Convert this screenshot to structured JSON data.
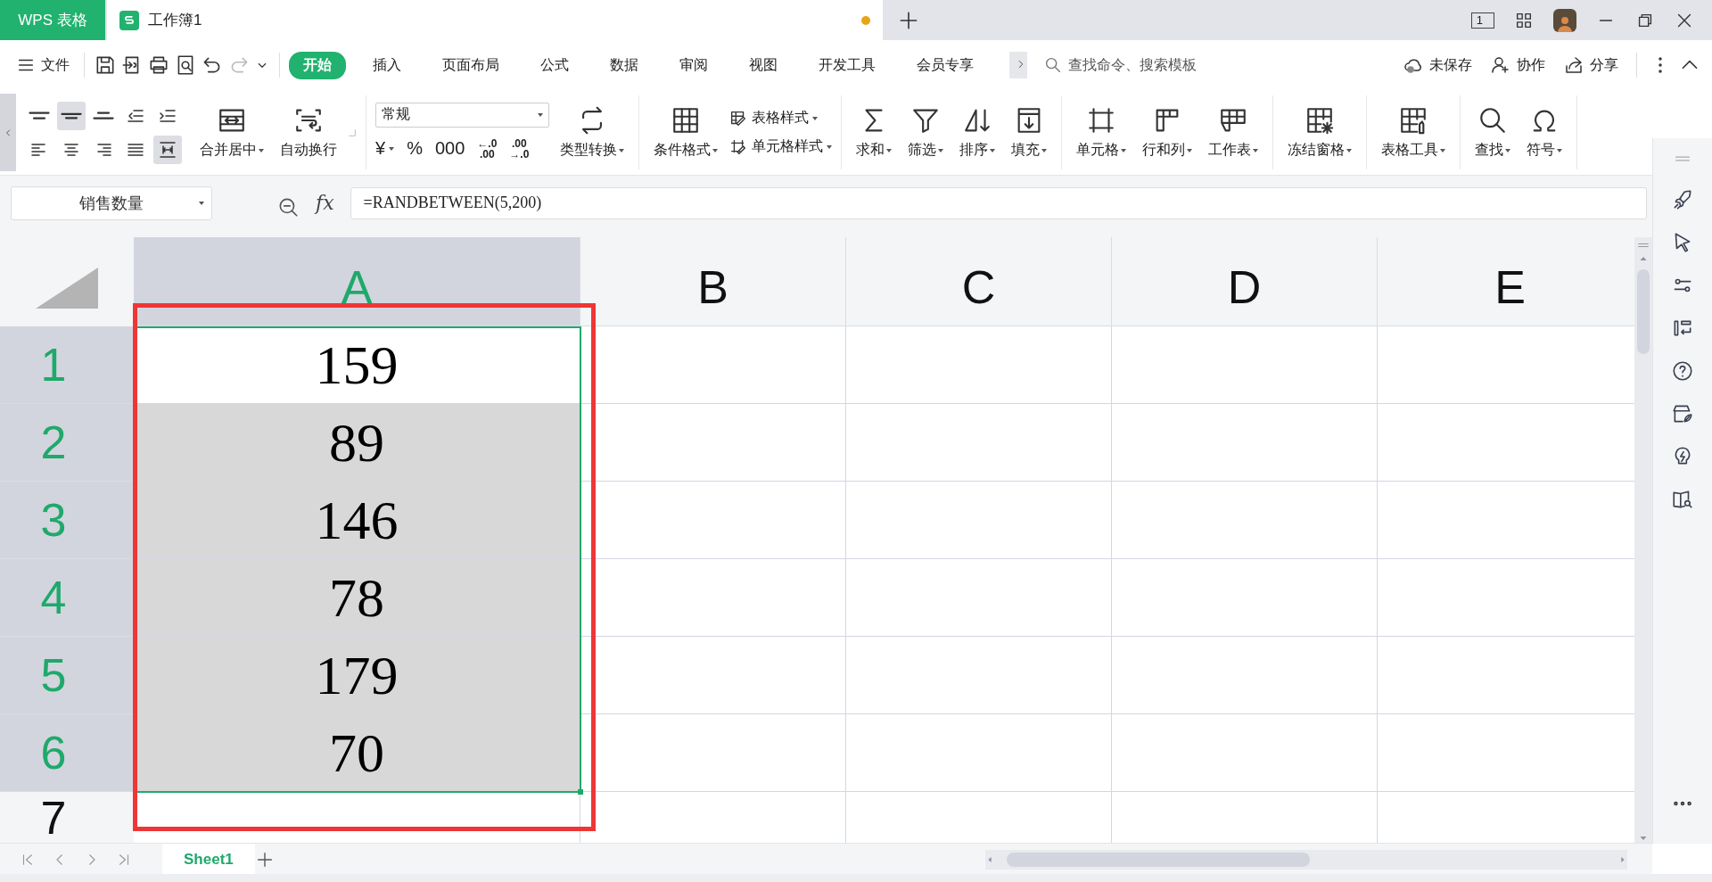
{
  "title_bar": {
    "app_tab": "WPS 表格",
    "doc_tab": {
      "title": "工作簿1",
      "modified": true
    },
    "page_indicator": "1"
  },
  "menu": {
    "file": "文件",
    "tabs": [
      {
        "label": "开始",
        "selected": true
      },
      {
        "label": "插入",
        "selected": false
      },
      {
        "label": "页面布局",
        "selected": false
      },
      {
        "label": "公式",
        "selected": false
      },
      {
        "label": "数据",
        "selected": false
      },
      {
        "label": "审阅",
        "selected": false
      },
      {
        "label": "视图",
        "selected": false
      },
      {
        "label": "开发工具",
        "selected": false
      },
      {
        "label": "会员专享",
        "selected": false
      }
    ],
    "search": {
      "placeholder": "查找命令、搜索模板"
    },
    "save_status": "未保存",
    "collaborate": "协作",
    "share": "分享"
  },
  "ribbon": {
    "groups": [
      {
        "kind": "align",
        "buttons": [
          {
            "selected": false
          },
          {
            "selected": true
          },
          {
            "selected": false
          },
          {
            "selected": false
          },
          {
            "selected": false
          },
          {
            "selected": false
          },
          {
            "selected": false
          },
          {
            "selected": false
          },
          {
            "selected": false
          },
          {
            "selected": true
          }
        ],
        "items": [
          {
            "label": "合并居中",
            "dropdown": true
          },
          {
            "label": "自动换行",
            "dropdown": false
          }
        ]
      },
      {
        "kind": "number",
        "format": "常规",
        "buttons": [
          {
            "kind": "text",
            "label": "¥",
            "dropdown": true
          },
          {
            "kind": "text",
            "label": "%"
          },
          {
            "kind": "text",
            "label": "000"
          },
          {
            "kind": "stack",
            "top": "←.0",
            "bottom": ".00"
          },
          {
            "kind": "stack",
            "top": ".00",
            "bottom": "→.0"
          }
        ],
        "items": [
          {
            "label": "类型转换",
            "dropdown": true
          }
        ]
      },
      {
        "kind": "styles",
        "items": [
          {
            "label": "条件格式",
            "dropdown": true
          }
        ],
        "small": [
          {
            "label": "表格样式",
            "dropdown": true
          },
          {
            "label": "单元格样式",
            "dropdown": true
          }
        ]
      },
      {
        "kind": "large",
        "items": [
          {
            "label": "求和",
            "dropdown": true
          },
          {
            "label": "筛选",
            "dropdown": true
          },
          {
            "label": "排序",
            "dropdown": true
          },
          {
            "label": "填充",
            "dropdown": true
          }
        ]
      },
      {
        "kind": "large",
        "items": [
          {
            "label": "单元格",
            "dropdown": true
          },
          {
            "label": "行和列",
            "dropdown": true
          },
          {
            "label": "工作表",
            "dropdown": true
          }
        ]
      },
      {
        "kind": "large",
        "items": [
          {
            "label": "冻结窗格",
            "dropdown": true
          }
        ]
      },
      {
        "kind": "large",
        "items": [
          {
            "label": "表格工具",
            "dropdown": true
          }
        ]
      },
      {
        "kind": "large",
        "items": [
          {
            "label": "查找",
            "dropdown": true
          },
          {
            "label": "符号",
            "dropdown": true
          }
        ]
      }
    ]
  },
  "formula_bar": {
    "name_box": "销售数量",
    "fx": "fx",
    "formula": "=RANDBETWEEN(5,200)"
  },
  "sheet": {
    "columns": [
      {
        "label": "A",
        "selected": true
      },
      {
        "label": "B",
        "selected": false
      },
      {
        "label": "C",
        "selected": false
      },
      {
        "label": "D",
        "selected": false
      },
      {
        "label": "E",
        "selected": false
      }
    ],
    "rows": [
      {
        "label": "1",
        "selected": true,
        "cells": [
          {
            "value": "159",
            "active": true
          }
        ]
      },
      {
        "label": "2",
        "selected": true,
        "cells": [
          {
            "value": "89",
            "active": false
          }
        ]
      },
      {
        "label": "3",
        "selected": true,
        "cells": [
          {
            "value": "146",
            "active": false
          }
        ]
      },
      {
        "label": "4",
        "selected": true,
        "cells": [
          {
            "value": "78",
            "active": false
          }
        ]
      },
      {
        "label": "5",
        "selected": true,
        "cells": [
          {
            "value": "179",
            "active": false
          }
        ]
      },
      {
        "label": "6",
        "selected": true,
        "cells": [
          {
            "value": "70",
            "active": false
          }
        ]
      },
      {
        "label": "7",
        "selected": false
      }
    ]
  },
  "sheet_tabs": [
    {
      "label": "Sheet1",
      "selected": true
    }
  ]
}
